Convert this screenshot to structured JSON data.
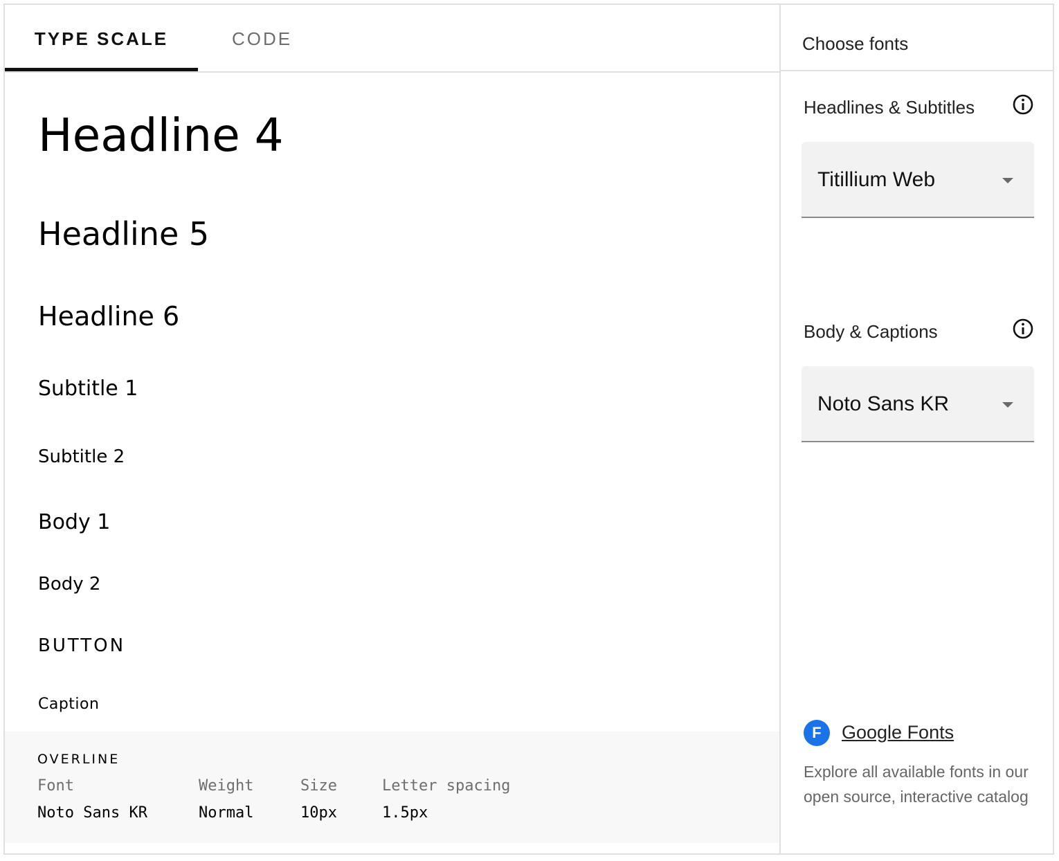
{
  "tabs": {
    "type_scale": "TYPE SCALE",
    "code": "CODE"
  },
  "samples": {
    "headline4": "Headline 4",
    "headline5": "Headline 5",
    "headline6": "Headline 6",
    "subtitle1": "Subtitle 1",
    "subtitle2": "Subtitle 2",
    "body1": "Body 1",
    "body2": "Body 2",
    "button": "BUTTON",
    "caption": "Caption"
  },
  "overline": {
    "title": "OVERLINE",
    "headers": {
      "font": "Font",
      "weight": "Weight",
      "size": "Size",
      "letter_spacing": "Letter spacing"
    },
    "values": {
      "font": "Noto Sans KR",
      "weight": "Normal",
      "size": "10px",
      "letter_spacing": "1.5px"
    }
  },
  "sidebar": {
    "title": "Choose fonts",
    "headlines_label": "Headlines & Subtitles",
    "headlines_font": "Titillium Web",
    "body_label": "Body & Captions",
    "body_font": "Noto Sans KR",
    "google_fonts_icon_letter": "F",
    "google_fonts_link": "Google Fonts",
    "google_fonts_desc": "Explore all available fonts in our open source, interactive catalog"
  },
  "colors": {
    "accent": "#1a73e8",
    "tab_indicator": "#111111",
    "panel_bg": "#f8f8f8",
    "select_bg": "#f2f2f2"
  }
}
